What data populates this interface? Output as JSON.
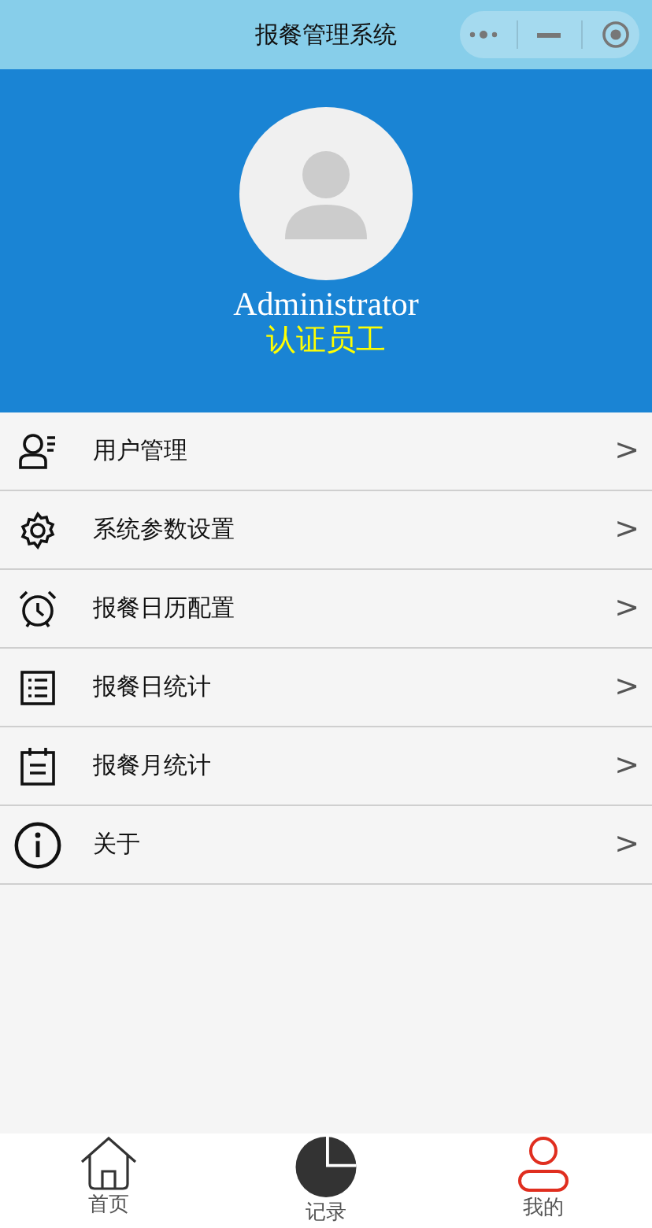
{
  "window": {
    "title": "报餐管理系统"
  },
  "profile": {
    "name": "Administrator",
    "role": "认证员工"
  },
  "menu": [
    {
      "kind": "user",
      "label": "用户管理",
      "chevron": ">"
    },
    {
      "kind": "gear",
      "label": "系统参数设置",
      "chevron": ">"
    },
    {
      "kind": "alarm",
      "label": "报餐日历配置",
      "chevron": ">"
    },
    {
      "kind": "list",
      "label": "报餐日统计",
      "chevron": ">"
    },
    {
      "kind": "calendar",
      "label": "报餐月统计",
      "chevron": ">"
    },
    {
      "kind": "info",
      "label": "关于",
      "chevron": ">"
    }
  ],
  "tabs": [
    {
      "kind": "home",
      "label": "首页",
      "selected": false
    },
    {
      "kind": "pie",
      "label": "记录",
      "selected": false
    },
    {
      "kind": "user",
      "label": "我的",
      "selected": true
    }
  ]
}
